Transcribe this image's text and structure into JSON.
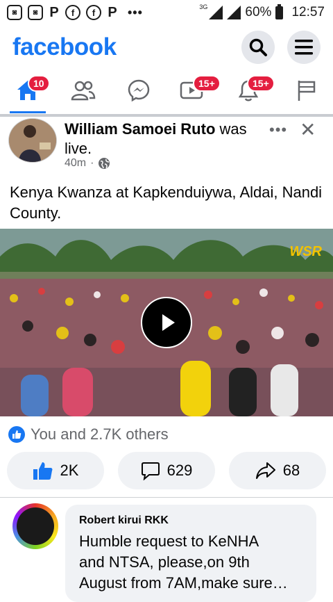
{
  "status_bar": {
    "icons": [
      "app-icon-1",
      "app-icon-2",
      "p-icon",
      "facebook-icon",
      "facebook-icon",
      "p-icon"
    ],
    "more": "•••",
    "network": "3G",
    "battery": "60%",
    "time": "12:57"
  },
  "header": {
    "logo": "facebook"
  },
  "tabs": {
    "home_badge": "10",
    "video_badge": "15+",
    "notifications_badge": "15+"
  },
  "post": {
    "author": "William Samoei Ruto",
    "action": " was live.",
    "time": "40m",
    "separator": "·",
    "text": "Kenya Kwanza at Kapkenduiywa, Aldai, Nandi County.",
    "watermark": "WSR",
    "reactions_text": "You and 2.7K others",
    "like_count": "2K",
    "comment_count": "629",
    "share_count": "68"
  },
  "comment": {
    "author": "Robert kirui RKK",
    "text_lines": [
      "Humble request to KeNHA",
      "and NTSA, please,on 9th",
      "August from 7AM,make sure…"
    ]
  },
  "colors": {
    "brand": "#1877f2",
    "badge": "#e41e3f"
  }
}
